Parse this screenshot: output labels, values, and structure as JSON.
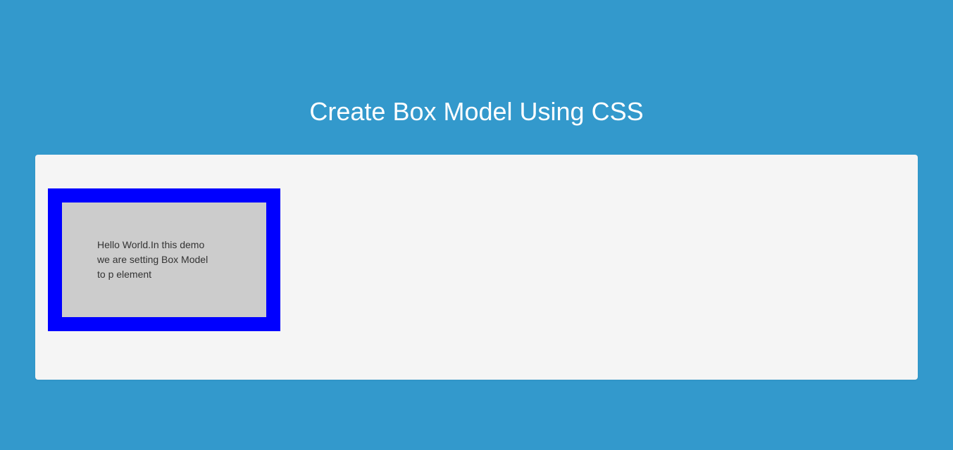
{
  "page": {
    "title": "Create Box Model Using CSS"
  },
  "demo": {
    "paragraph_text": "Hello World.In this demo we are setting Box Model to p element"
  }
}
